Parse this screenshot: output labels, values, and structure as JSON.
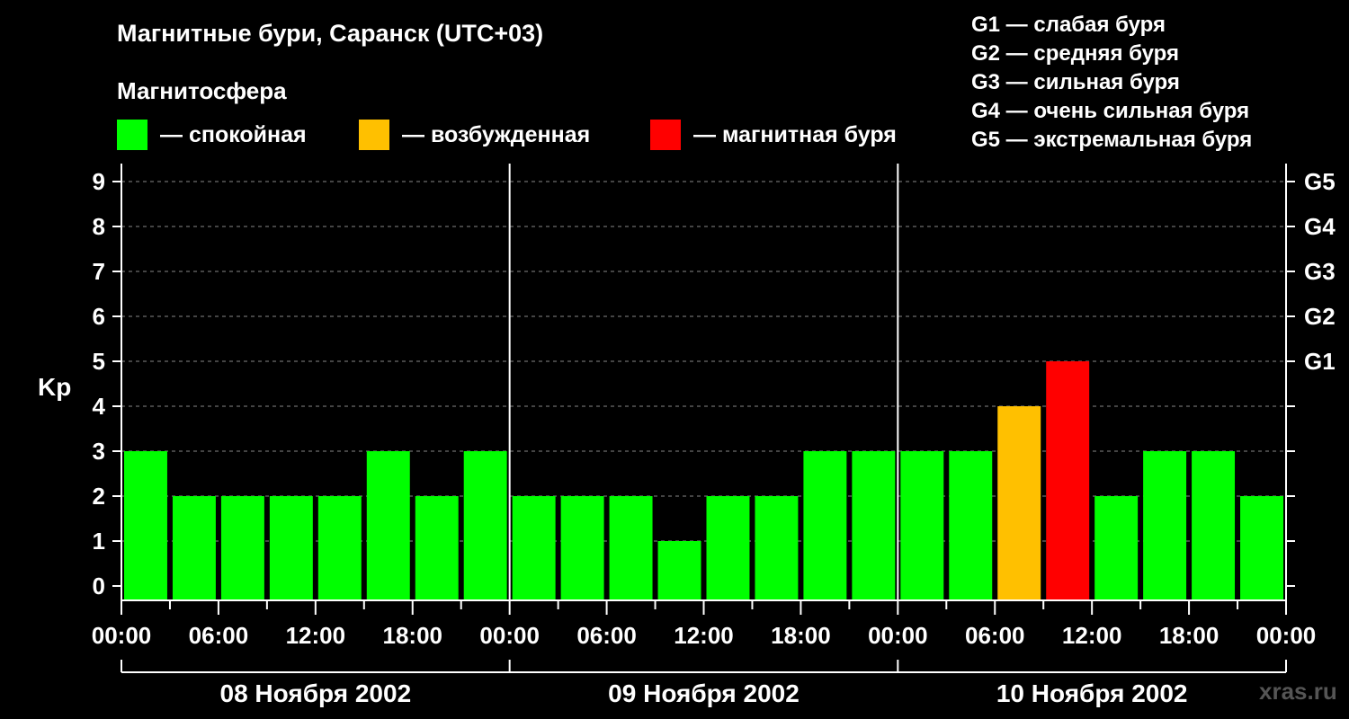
{
  "title": "Магнитные бури, Саранск (UTC+03)",
  "subtitle": "Магнитосфера",
  "legend": [
    {
      "label": "— спокойная",
      "color": "#00ff00"
    },
    {
      "label": "— возбужденная",
      "color": "#ffc000"
    },
    {
      "label": "— магнитная буря",
      "color": "#ff0000"
    }
  ],
  "g_legend": [
    "G1 — слабая буря",
    "G2 — средняя буря",
    "G3 — сильная буря",
    "G4 — очень сильная буря",
    "G5 — экстремальная буря"
  ],
  "watermark": "xras.ru",
  "chart_data": {
    "type": "bar",
    "ylabel": "Kp",
    "ylim": [
      0,
      9
    ],
    "yticks": [
      "0",
      "1",
      "2",
      "3",
      "4",
      "5",
      "6",
      "7",
      "8",
      "9"
    ],
    "right_labels": [
      {
        "value": 5,
        "label": "G1"
      },
      {
        "value": 6,
        "label": "G2"
      },
      {
        "value": 7,
        "label": "G3"
      },
      {
        "value": 8,
        "label": "G4"
      },
      {
        "value": 9,
        "label": "G5"
      }
    ],
    "xticks": [
      "00:00",
      "06:00",
      "12:00",
      "18:00",
      "00:00",
      "06:00",
      "12:00",
      "18:00",
      "00:00",
      "06:00",
      "12:00",
      "18:00",
      "00:00"
    ],
    "days": [
      "08 Ноября 2002",
      "09 Ноября 2002",
      "10 Ноября 2002"
    ],
    "interval_hours": 3,
    "values": [
      3,
      2,
      2,
      2,
      2,
      3,
      2,
      3,
      2,
      2,
      2,
      1,
      2,
      2,
      3,
      3,
      3,
      3,
      4,
      5,
      2,
      3,
      3,
      2
    ],
    "colors": {
      "quiet": "#00ff00",
      "active": "#ffc000",
      "storm": "#ff0000"
    },
    "grid": true
  }
}
